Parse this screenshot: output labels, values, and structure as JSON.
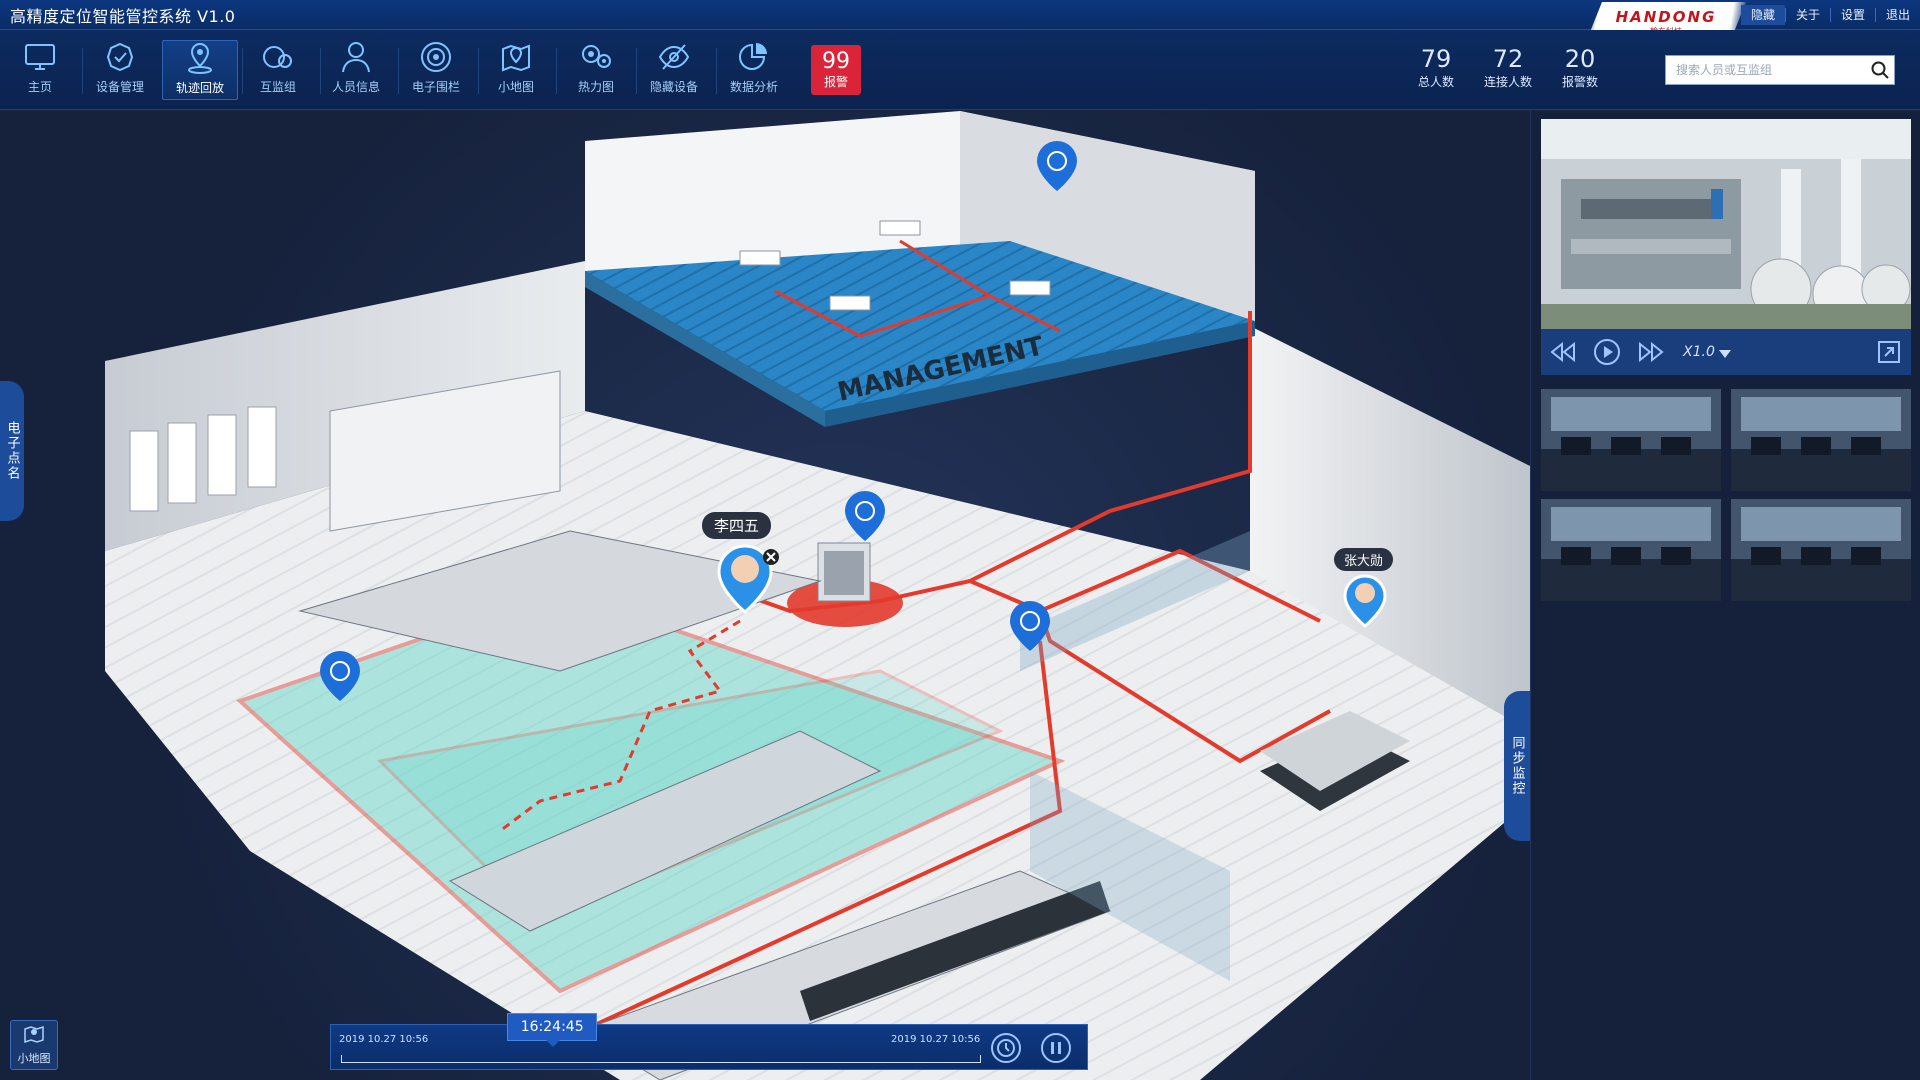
{
  "app": {
    "title": "高精度定位智能管控系统   V1.0",
    "brand_name": "HANDONG",
    "brand_sub": "翰东科技",
    "top_links": [
      "隐藏",
      "关于",
      "设置",
      "退出"
    ]
  },
  "toolbar": {
    "items": [
      {
        "label": "主页",
        "icon": "monitor-icon"
      },
      {
        "label": "设备管理",
        "icon": "shield-check-icon"
      },
      {
        "label": "轨迹回放",
        "icon": "location-pin-icon",
        "active": true
      },
      {
        "label": "互监组",
        "icon": "group-circles-icon"
      },
      {
        "label": "人员信息",
        "icon": "user-icon"
      },
      {
        "label": "电子围栏",
        "icon": "fence-target-icon"
      },
      {
        "label": "小地图",
        "icon": "map-pin-icon"
      },
      {
        "label": "热力图",
        "icon": "heatmap-icon"
      },
      {
        "label": "隐藏设备",
        "icon": "eye-hidden-icon"
      },
      {
        "label": "数据分析",
        "icon": "pie-chart-icon"
      }
    ],
    "alarm": {
      "count": "99",
      "label": "报警"
    }
  },
  "stats": [
    {
      "value": "79",
      "label": "总人数"
    },
    {
      "value": "72",
      "label": "连接人数"
    },
    {
      "value": "20",
      "label": "报警数"
    }
  ],
  "search": {
    "placeholder": "搜索人员或互监组",
    "value": ""
  },
  "map": {
    "zone_label": "MANAGEMENT",
    "people": [
      {
        "name": "李四五"
      },
      {
        "name": "张大勋"
      }
    ],
    "left_tab": "电子点名",
    "right_tab": "同步监控",
    "minimap_label": "小地图"
  },
  "timeline": {
    "start": "2019  10.27  10:56",
    "end": "2019  10.27  10:56",
    "current": "16:24:45",
    "progress": 0.33
  },
  "video": {
    "speed": "X1.0"
  },
  "colors": {
    "accent": "#1d4c9b",
    "alarm": "#d9243a",
    "route": "#e33a2c",
    "zone_teal": "#5fd7c8",
    "zone_blue": "#2a86c6"
  }
}
